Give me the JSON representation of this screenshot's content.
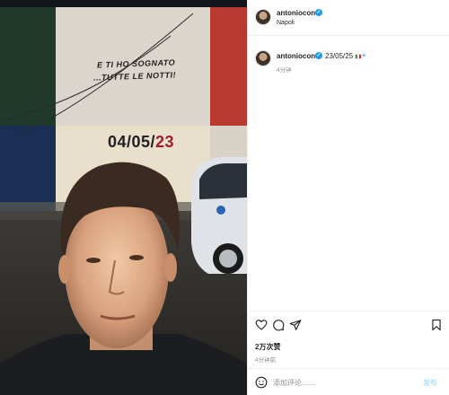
{
  "post": {
    "author": "antonioconte",
    "location": "Napoli",
    "caption_text": "23/05/25",
    "caption_time": "4分钟",
    "likes": "2万次赞",
    "post_time": "4分钟前",
    "comment_placeholder": "添加评论……",
    "post_button": "发布"
  },
  "photo": {
    "wall_line1": "E TI HO SOGNATO",
    "wall_line2": "...TUTTE LE NOTTI!",
    "wall_date": "04/05/",
    "wall_date_year": "23"
  },
  "icons": {
    "verified": "verified-badge-icon",
    "flag": "italy-flag-icon",
    "heart_small": "light-blue-heart-icon",
    "like": "heart-icon",
    "comment": "comment-icon",
    "share": "share-icon",
    "save": "bookmark-icon",
    "emoji": "emoji-icon"
  },
  "colors": {
    "verified": "#1d9bf0",
    "muted_text": "#8e8e8e",
    "post_button": "#b2dffc",
    "date_year": "#9e1f2c"
  }
}
